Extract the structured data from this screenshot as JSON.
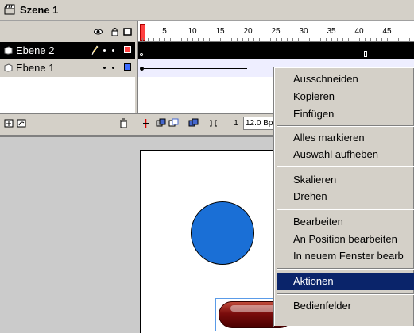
{
  "scene": {
    "title": "Szene 1",
    "icon": "scene-clapper-icon"
  },
  "timeline": {
    "header_icons": [
      "eye-icon",
      "lock-icon",
      "outline-icon"
    ],
    "ruler_labels": [
      "1",
      "5",
      "10",
      "15",
      "20",
      "25",
      "30",
      "35",
      "40",
      "45"
    ],
    "layers": [
      {
        "name": "Ebene 2",
        "selected": true,
        "icon": "layer-icon",
        "edit_icon": "pencil-icon",
        "color": "#ff4040"
      },
      {
        "name": "Ebene 1",
        "selected": false,
        "icon": "layer-icon",
        "color": "#3d6cff"
      }
    ],
    "current_frame": "1",
    "fps": "12.0 Bp",
    "bottom_icons": [
      "add-layer-icon",
      "add-guide-layer-icon",
      "trash-icon",
      "center-frame-icon",
      "onion-skin-icon",
      "onion-outline-icon",
      "edit-multiple-frames-icon",
      "modify-onion-markers-icon"
    ]
  },
  "context_menu": {
    "items": [
      {
        "label": "Ausschneiden",
        "highlighted": false
      },
      {
        "label": "Kopieren",
        "highlighted": false
      },
      {
        "label": "Einfügen",
        "highlighted": false
      },
      {
        "separator": true
      },
      {
        "label": "Alles markieren",
        "highlighted": false
      },
      {
        "label": "Auswahl aufheben",
        "highlighted": false
      },
      {
        "separator": true
      },
      {
        "label": "Skalieren",
        "highlighted": false
      },
      {
        "label": "Drehen",
        "highlighted": false
      },
      {
        "separator": true
      },
      {
        "label": "Bearbeiten",
        "highlighted": false
      },
      {
        "label": "An Position bearbeiten",
        "highlighted": false
      },
      {
        "label": "In neuem Fenster bearb",
        "highlighted": false
      },
      {
        "separator": true
      },
      {
        "label": "Aktionen",
        "highlighted": true
      },
      {
        "separator": true
      },
      {
        "label": "Bedienfelder",
        "highlighted": false
      }
    ]
  },
  "colors": {
    "circle_fill": "#1a6fd6",
    "pill_fill": "#7a0c0c",
    "menu_highlight": "#0a246a"
  }
}
